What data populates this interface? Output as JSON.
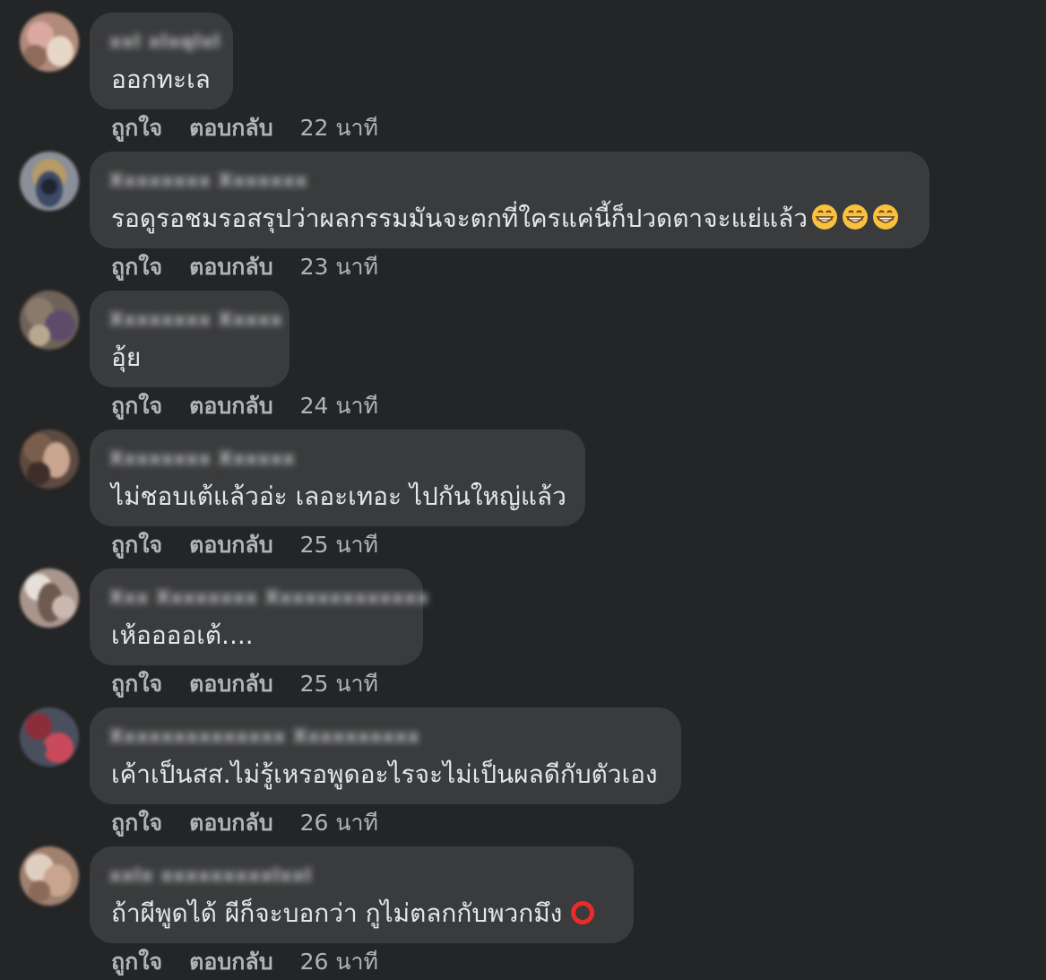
{
  "actions": {
    "like_label": "ถูกใจ",
    "reply_label": "ตอบกลับ"
  },
  "comments": [
    {
      "author": "xxl xlxqlxl",
      "text": "ออกทะเล",
      "time": "22 นาที",
      "avatar_colors": [
        "#d9a9a0",
        "#8f6b5a",
        "#e6d7c6"
      ]
    },
    {
      "author": "Xxxxxxxx Xxxxxxx",
      "text": "รอดูรอชมรอสรุปว่าผลกรรมมันจะตกที่ใครแค่นี้ก็ปวดตาจะแย่แล้ว",
      "emoji": [
        "grinning-face",
        "grinning-face",
        "grinning-face"
      ],
      "time": "23 นาที",
      "avatar_colors": [
        "#3c4a66",
        "#b89a66",
        "#1f2433"
      ]
    },
    {
      "author": "Xxxxxxxx Xxxxx",
      "text": "อุ้ย",
      "time": "24 นาที",
      "avatar_colors": [
        "#8a7a6c",
        "#5e4b6b",
        "#b8a88f"
      ]
    },
    {
      "author": "Xxxxxxxx Xxxxxx",
      "text": "ไม่ชอบเต้แล้วอ่ะ เลอะเทอะ ไปกันใหญ่แล้ว",
      "time": "25 นาที",
      "avatar_colors": [
        "#7a5d4d",
        "#c9a58f",
        "#3d2e29"
      ]
    },
    {
      "author": "Xxx Xxxxxxxx Xxxxxxxxxxxxx",
      "text": "เห้ออออเต้....",
      "time": "25 นาที",
      "avatar_colors": [
        "#c9b9b0",
        "#6f5a50",
        "#e8dfda"
      ]
    },
    {
      "author": "Xxxxxxxxxxxxxx Xxxxxxxxxx",
      "text": "เค้าเป็นสส.ไม่รู้เหรอพูดอะไรจะไม่เป็นผลดีกับตัวเอง",
      "time": "26 นาที",
      "avatar_colors": [
        "#8a2f3a",
        "#c94a5a",
        "#4a4f5e"
      ]
    },
    {
      "author": "xxlx xxxxxxxxxlxxl",
      "text": "ถ้าผีพูดได้ ผีก็จะบอกว่า กูไม่ตลกกับพวกมึง",
      "emoji": [
        "red-circle"
      ],
      "time": "26 นาที",
      "avatar_colors": [
        "#c9a58f",
        "#8a6b5a",
        "#e0cfc0"
      ]
    }
  ]
}
